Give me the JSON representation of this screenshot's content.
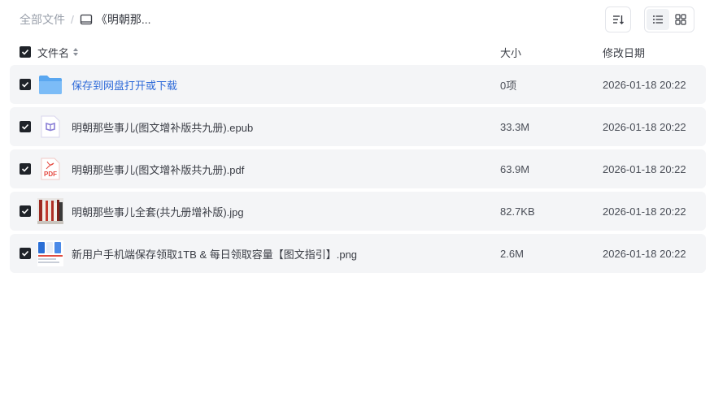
{
  "breadcrumb": {
    "root": "全部文件",
    "separator": "/",
    "current": "《明朝那..."
  },
  "toolbar": {
    "sort_icon": "sort-icon",
    "list_view_icon": "list-view-icon",
    "grid_view_icon": "grid-view-icon",
    "active_view": "list"
  },
  "table": {
    "headers": {
      "name": "文件名",
      "size": "大小",
      "date": "修改日期"
    },
    "rows": [
      {
        "icon": "folder-icon",
        "name": "保存到网盘打开或下载",
        "size": "0项",
        "date": "2026-01-18 20:22",
        "link": true
      },
      {
        "icon": "epub-icon",
        "name": "明朝那些事儿(图文增补版共九册).epub",
        "size": "33.3M",
        "date": "2026-01-18 20:22",
        "link": false
      },
      {
        "icon": "pdf-icon",
        "name": "明朝那些事儿(图文增补版共九册).pdf",
        "size": "63.9M",
        "date": "2026-01-18 20:22",
        "link": false,
        "icon_text": "PDF"
      },
      {
        "icon": "image-thumbnail-icon",
        "name": "明朝那些事儿全套(共九册增补版).jpg",
        "size": "82.7KB",
        "date": "2026-01-18 20:22",
        "link": false
      },
      {
        "icon": "image-thumbnail-icon",
        "name": "新用户手机端保存领取1TB & 每日领取容量【图文指引】.png",
        "size": "2.6M",
        "date": "2026-01-18 20:22",
        "link": false
      }
    ]
  },
  "colors": {
    "link": "#2f6bd9",
    "row_bg": "#f4f5f7",
    "checkbox": "#1f2329",
    "folder": "#6cb3f5",
    "pdf": "#e5483f",
    "epub": "#8a7fd6"
  }
}
